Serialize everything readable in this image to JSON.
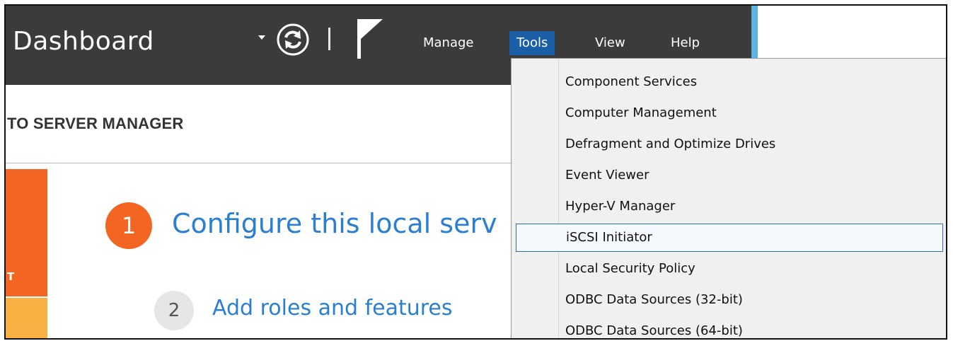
{
  "header": {
    "title": "Dashboard",
    "menus": [
      {
        "label": "Manage"
      },
      {
        "label": "Tools",
        "active": true
      },
      {
        "label": "View"
      },
      {
        "label": "Help"
      }
    ],
    "icons": [
      "dropdown-arrow-icon",
      "refresh-icon",
      "flag-icon"
    ]
  },
  "welcome": {
    "text": "TO SERVER MANAGER"
  },
  "tile": {
    "text": "T"
  },
  "quickstart": {
    "step1": {
      "number": "1",
      "label": "Configure this local serv"
    },
    "step2": {
      "number": "2",
      "label": "Add roles and features"
    }
  },
  "tools_menu": {
    "items": [
      {
        "label": "Component Services"
      },
      {
        "label": "Computer Management"
      },
      {
        "label": "Defragment and Optimize Drives"
      },
      {
        "label": "Event Viewer"
      },
      {
        "label": "Hyper-V Manager"
      },
      {
        "label": "iSCSI Initiator",
        "highlighted": true
      },
      {
        "label": "Local Security Policy"
      },
      {
        "label": "ODBC Data Sources (32-bit)"
      },
      {
        "label": "ODBC Data Sources (64-bit)"
      }
    ]
  },
  "colors": {
    "header_bg": "#3b3b3b",
    "accent_blue": "#1a5ea8",
    "link_blue": "#2a7fd0",
    "orange": "#f26522",
    "yellow": "#f9b042"
  }
}
